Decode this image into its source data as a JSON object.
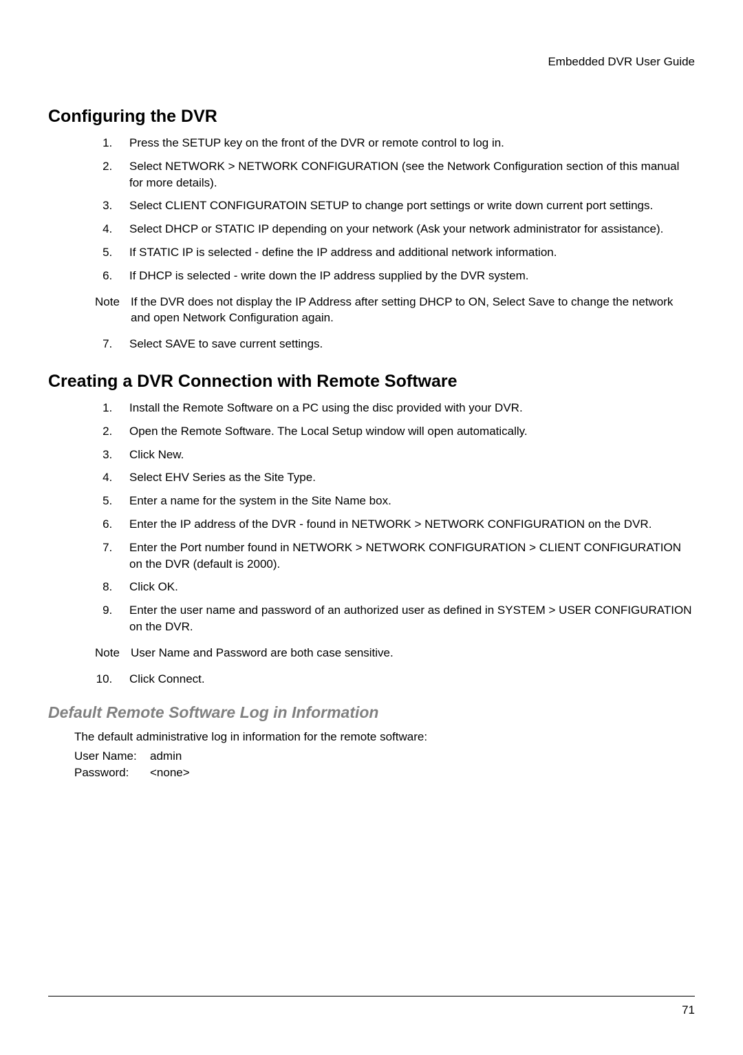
{
  "header": "Embedded DVR User Guide",
  "section1": {
    "title": "Configuring the DVR",
    "steps": [
      {
        "pre": "Press the ",
        "ui": "SETUP",
        "post": " key on the front of the DVR or remote control to log in."
      },
      {
        "pre": "Select ",
        "ui": "NETWORK > NETWORK CONFIGURATION",
        "post": " (see the Network Configuration section of this manual for more details)."
      },
      {
        "pre": "Select ",
        "ui": "CLIENT CONFIGURATOIN SETUP",
        "post": " to change port settings or write down current port settings."
      },
      {
        "pre": "Select ",
        "ui": "DHCP",
        "mid": " or ",
        "ui2": "STATIC IP",
        "post": " depending on your network (Ask your network administrator for assistance)."
      },
      {
        "pre": "If ",
        "ui": "STATIC IP",
        "post": " is selected - define the IP address and additional network information."
      },
      {
        "pre": "If ",
        "ui": "DHCP",
        "post": " is selected - write down the IP address supplied by the DVR system."
      }
    ],
    "note_label": "Note",
    "note_body": "If the DVR does not display the IP Address after setting DHCP to ON, Select Save to change the network and open Network Configuration again.",
    "step7": {
      "pre": "Select ",
      "ui": "SAVE",
      "post": " to save current settings."
    }
  },
  "section2": {
    "title": "Creating a DVR Connection with Remote Software",
    "steps": [
      {
        "text": "Install the Remote Software on a PC using the disc provided with your DVR."
      },
      {
        "pre": "Open the Remote Software. The ",
        "ui": "Local Setup",
        "post": " window will open automatically."
      },
      {
        "pre": "Click ",
        "ui": "New",
        "post": "."
      },
      {
        "pre": "Select ",
        "ui": "EHV Series",
        "mid": " as the ",
        "ui2": "Site Type",
        "post": "."
      },
      {
        "pre": "Enter a name for the system in the ",
        "ui": "Site Name",
        "post": " box."
      },
      {
        "pre": "Enter the IP address of the DVR - found in ",
        "ui": "NETWORK > NETWORK CONFIGURATION",
        "post": " on the DVR."
      },
      {
        "pre": "Enter the Port number found in ",
        "ui": "NETWORK > NETWORK CONFIGURATION > CLIENT CONFIGURATION",
        "post": " on the DVR (default is 2000)."
      },
      {
        "pre": "Click ",
        "ui": "OK",
        "post": "."
      },
      {
        "pre": "Enter the user name and password of an authorized user as defined in ",
        "ui": "SYSTEM > USER CONFIGURATION",
        "post": " on the DVR."
      }
    ],
    "note_label": "Note",
    "note_body": "User Name and Password are both case sensitive.",
    "step10": {
      "pre": "Click ",
      "ui": "Connect",
      "post": "."
    }
  },
  "section3": {
    "title": "Default Remote Software Log in Information",
    "intro": "The default administrative log in information for the remote software:",
    "user_label": "User Name:",
    "user_value": "admin",
    "pass_label": "Password:",
    "pass_value": "<none>"
  },
  "page_number": "71"
}
